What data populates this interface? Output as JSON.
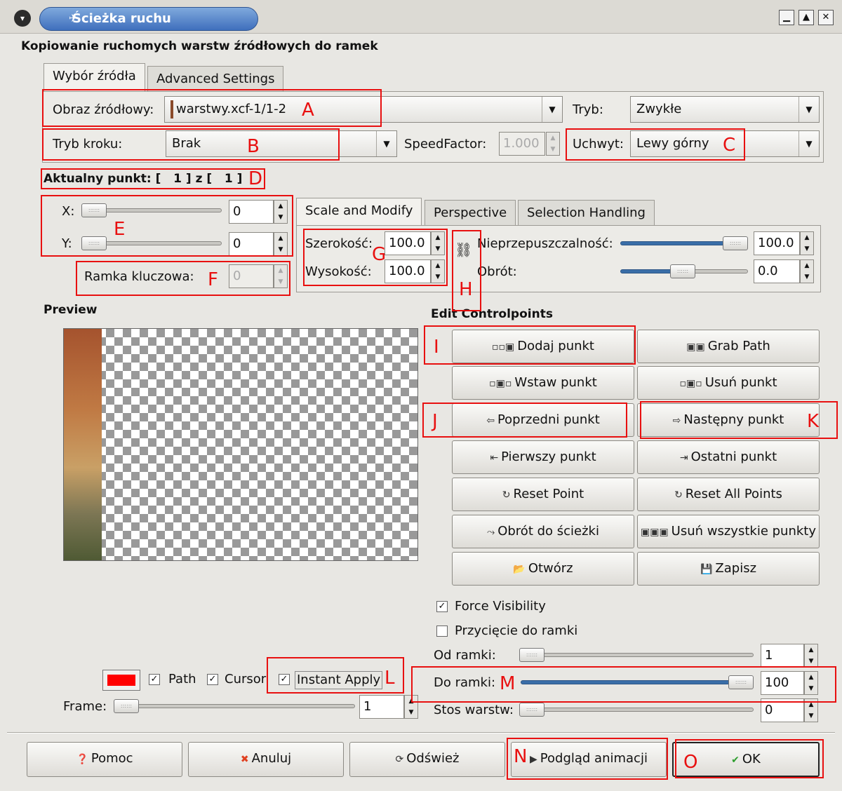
{
  "window": {
    "title": "Ścieżka ruchu",
    "heading": "Kopiowanie ruchomych warstw źródłowych do ramek"
  },
  "tabs_top": [
    "Wybór źródła",
    "Advanced Settings"
  ],
  "source": {
    "image_label": "Obraz źródłowy:",
    "image_value": "warstwy.xcf-1/1-2",
    "mode_label": "Tryb:",
    "mode_value": "Zwykłe",
    "step_label": "Tryb kroku:",
    "step_value": "Brak",
    "speed_label": "SpeedFactor:",
    "speed_value": "1.000",
    "handle_label": "Uchwyt:",
    "handle_value": "Lewy górny"
  },
  "current_point": "Aktualny punkt: [   1 ] z [   1 ]",
  "position": {
    "x_label": "X:",
    "x_value": "0",
    "y_label": "Y:",
    "y_value": "0",
    "keyframe_label": "Ramka kluczowa:",
    "keyframe_value": "0"
  },
  "tabs_inner": [
    "Scale and Modify",
    "Perspective",
    "Selection Handling"
  ],
  "modify": {
    "width_label": "Szerokość:",
    "width_value": "100.0",
    "height_label": "Wysokość:",
    "height_value": "100.0",
    "opacity_label": "Nieprzepuszczalność:",
    "opacity_value": "100.0",
    "rotation_label": "Obrót:",
    "rotation_value": "0.0"
  },
  "preview": {
    "label": "Preview",
    "path_label": "Path",
    "cursor_label": "Cursor",
    "instant_label": "Instant Apply",
    "frame_label": "Frame:",
    "frame_value": "1",
    "color": "#ff0000"
  },
  "edit": {
    "label": "Edit Controlpoints",
    "buttons": [
      "Dodaj punkt",
      "Grab Path",
      "Wstaw punkt",
      "Usuń punkt",
      "Poprzedni punkt",
      "Następny punkt",
      "Pierwszy punkt",
      "Ostatni punkt",
      "Reset Point",
      "Reset All Points",
      "Obrót do ścieżki",
      "Usuń wszystkie punkty",
      "Otwórz",
      "Zapisz"
    ]
  },
  "options": {
    "force_visibility": "Force Visibility",
    "clip_frame": "Przycięcie do ramki",
    "from_label": "Od ramki:",
    "from_value": "1",
    "to_label": "Do ramki:",
    "to_value": "100",
    "stack_label": "Stos warstw:",
    "stack_value": "0"
  },
  "bottom_buttons": [
    "Pomoc",
    "Anuluj",
    "Odśwież",
    "Podgląd animacji",
    "OK"
  ],
  "annotations": [
    "A",
    "B",
    "C",
    "D",
    "E",
    "F",
    "G",
    "H",
    "I",
    "J",
    "K",
    "L",
    "M",
    "N",
    "O"
  ]
}
